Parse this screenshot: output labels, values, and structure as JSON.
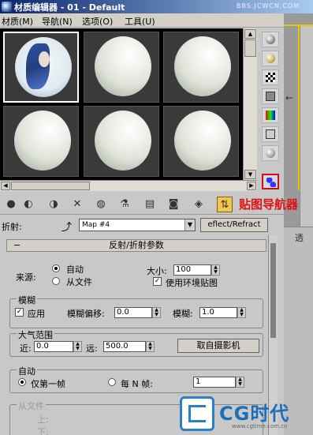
{
  "window": {
    "title": "材质编辑器 - 01 - Default",
    "watermark": "BBS.JCWCN.COM"
  },
  "menu": [
    "材质(M)",
    "导航(N)",
    "选项(O)",
    "工具(U)"
  ],
  "callout": "贴图导航器",
  "map_row": {
    "label": "折射:",
    "map_name": "Map #4",
    "type_button": "eflect/Refract"
  },
  "rollout": {
    "title": "反射/折射参数",
    "source": {
      "label": "来源:",
      "auto": "自动",
      "from_file": "从文件",
      "selected": "自动"
    },
    "size": {
      "label": "大小:",
      "value": "100"
    },
    "use_env_map": {
      "label": "使用环境贴图",
      "checked": true
    },
    "blur_group": {
      "title": "模糊",
      "apply": "应用",
      "apply_checked": true,
      "blur_offset_label": "模糊偏移:",
      "blur_offset": "0.0",
      "blur_label": "模糊:",
      "blur": "1.0"
    },
    "atmosphere": {
      "title": "大气范围",
      "near_label": "近:",
      "near": "0.0",
      "far_label": "远:",
      "far": "500.0",
      "camera_button": "取自摄影机"
    },
    "auto_group": {
      "title": "自动",
      "first_frame": "仅第一帧",
      "every_n": "每 N 帧:",
      "n_value": "1",
      "selected": "仅第一帧"
    },
    "from_file_group": {
      "title": "从文件",
      "up": "上:",
      "down": "下:"
    }
  },
  "viewport": {
    "cut_text": "透"
  },
  "logo": {
    "brand": "CG时代",
    "url": "www.cgtime.com.cn"
  },
  "colors": {
    "highlight_red": "#d01010",
    "callout_red": "#e01010",
    "titlebar": "#0a246a"
  }
}
